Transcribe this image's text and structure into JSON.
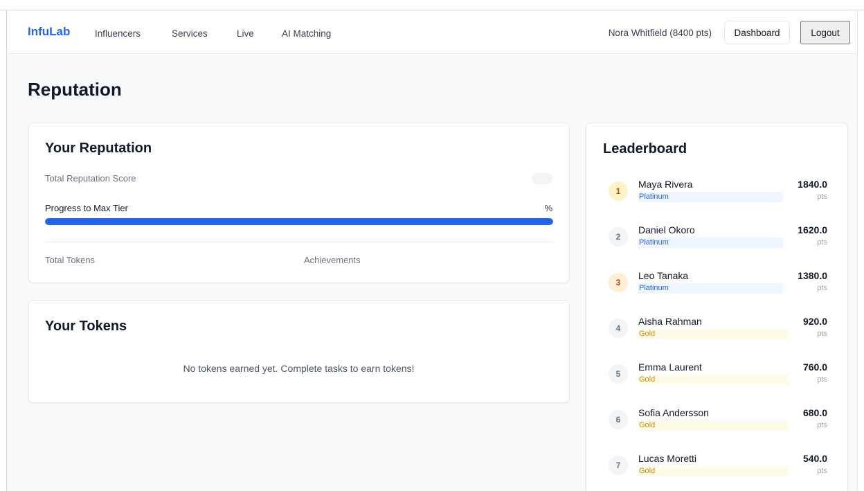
{
  "nav": {
    "brand": "InfuLab",
    "links": [
      "Influencers",
      "Services",
      "Live",
      "AI Matching"
    ],
    "user": "Nora Whitfield (8400 pts)",
    "dashboard": "Dashboard",
    "logout": "Logout"
  },
  "page": {
    "title": "Reputation"
  },
  "reputation": {
    "title": "Your Reputation",
    "score_label": "Total Reputation Score",
    "progress_label": "Progress to Max Tier",
    "progress_pct_text": "%",
    "progress_fraction": 1.0,
    "total_tokens_label": "Total Tokens",
    "achievements_label": "Achievements"
  },
  "tokens": {
    "title": "Your Tokens",
    "empty": "No tokens earned yet. Complete tasks to earn tokens!"
  },
  "leaderboard": {
    "title": "Leaderboard",
    "unit": "pts",
    "rows": [
      {
        "rank": "1",
        "name": "Maya Rivera",
        "tier": "Platinum",
        "points": "1840.0",
        "rank_style": "gold"
      },
      {
        "rank": "2",
        "name": "Daniel Okoro",
        "tier": "Platinum",
        "points": "1620.0",
        "rank_style": "plain"
      },
      {
        "rank": "3",
        "name": "Leo Tanaka",
        "tier": "Platinum",
        "points": "1380.0",
        "rank_style": "bronze"
      },
      {
        "rank": "4",
        "name": "Aisha Rahman",
        "tier": "Gold",
        "points": "920.0",
        "rank_style": "plain"
      },
      {
        "rank": "5",
        "name": "Emma Laurent",
        "tier": "Gold",
        "points": "760.0",
        "rank_style": "plain"
      },
      {
        "rank": "6",
        "name": "Sofia Andersson",
        "tier": "Gold",
        "points": "680.0",
        "rank_style": "plain"
      },
      {
        "rank": "7",
        "name": "Lucas Moretti",
        "tier": "Gold",
        "points": "540.0",
        "rank_style": "plain"
      }
    ]
  },
  "colors": {
    "accent": "#2563eb",
    "page_bg": "#f9fafb",
    "platinum_bg": "#eff6ff",
    "gold_bg": "#fefce8"
  }
}
